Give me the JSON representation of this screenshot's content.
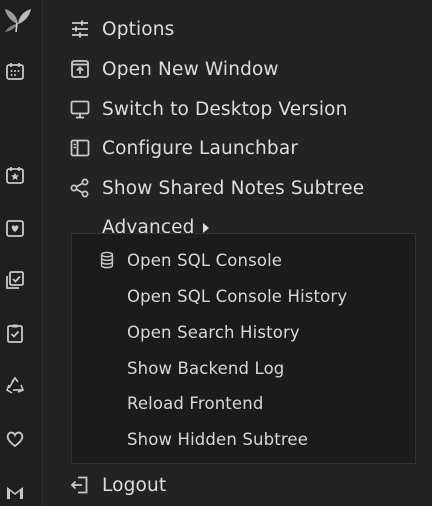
{
  "colors": {
    "background": "#1f1f1f",
    "menu_bg": "#232323",
    "submenu_bg": "#1b1b1b",
    "text": "#dedede",
    "icon": "#c8c8c8"
  },
  "launchbar": {
    "icons": [
      "trilium-logo-icon",
      "calendar-icon",
      "star-calendar-icon",
      "heart-square-icon",
      "checklist-icon",
      "clipboard-check-icon",
      "recycle-icon",
      "heart-icon",
      "gmail-icon"
    ]
  },
  "menu": {
    "items": [
      {
        "label": "Options",
        "icon": "sliders-icon"
      },
      {
        "label": "Open New Window",
        "icon": "window-open-icon"
      },
      {
        "label": "Switch to Desktop Version",
        "icon": "desktop-icon"
      },
      {
        "label": "Configure Launchbar",
        "icon": "layout-sidebar-icon"
      },
      {
        "label": "Show Shared Notes Subtree",
        "icon": "share-icon"
      },
      {
        "label": "Advanced",
        "icon": "caret-right-icon"
      },
      {
        "label": "Logout",
        "icon": "logout-icon"
      }
    ]
  },
  "submenu": {
    "items": [
      {
        "label": "Open SQL Console",
        "icon": "database-icon"
      },
      {
        "label": "Open SQL Console History"
      },
      {
        "label": "Open Search History"
      },
      {
        "label": "Show Backend Log"
      },
      {
        "label": "Reload Frontend"
      },
      {
        "label": "Show Hidden Subtree"
      }
    ]
  }
}
